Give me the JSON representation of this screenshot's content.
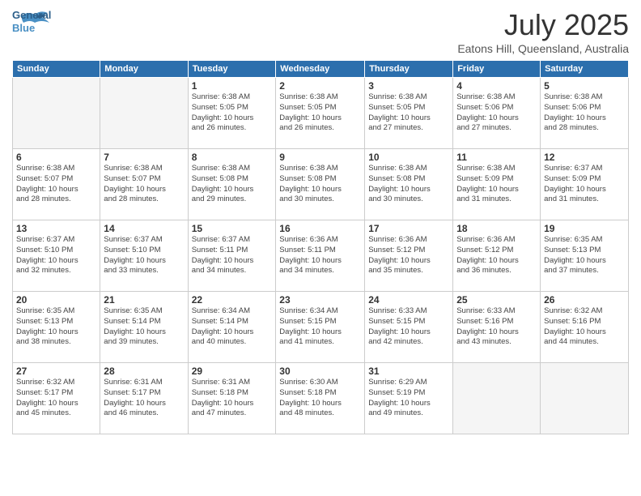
{
  "header": {
    "logo_general": "General",
    "logo_blue": "Blue",
    "title": "July 2025",
    "location": "Eatons Hill, Queensland, Australia"
  },
  "days_of_week": [
    "Sunday",
    "Monday",
    "Tuesday",
    "Wednesday",
    "Thursday",
    "Friday",
    "Saturday"
  ],
  "weeks": [
    [
      {
        "day": "",
        "info": ""
      },
      {
        "day": "",
        "info": ""
      },
      {
        "day": "1",
        "info": "Sunrise: 6:38 AM\nSunset: 5:05 PM\nDaylight: 10 hours\nand 26 minutes."
      },
      {
        "day": "2",
        "info": "Sunrise: 6:38 AM\nSunset: 5:05 PM\nDaylight: 10 hours\nand 26 minutes."
      },
      {
        "day": "3",
        "info": "Sunrise: 6:38 AM\nSunset: 5:05 PM\nDaylight: 10 hours\nand 27 minutes."
      },
      {
        "day": "4",
        "info": "Sunrise: 6:38 AM\nSunset: 5:06 PM\nDaylight: 10 hours\nand 27 minutes."
      },
      {
        "day": "5",
        "info": "Sunrise: 6:38 AM\nSunset: 5:06 PM\nDaylight: 10 hours\nand 28 minutes."
      }
    ],
    [
      {
        "day": "6",
        "info": "Sunrise: 6:38 AM\nSunset: 5:07 PM\nDaylight: 10 hours\nand 28 minutes."
      },
      {
        "day": "7",
        "info": "Sunrise: 6:38 AM\nSunset: 5:07 PM\nDaylight: 10 hours\nand 28 minutes."
      },
      {
        "day": "8",
        "info": "Sunrise: 6:38 AM\nSunset: 5:08 PM\nDaylight: 10 hours\nand 29 minutes."
      },
      {
        "day": "9",
        "info": "Sunrise: 6:38 AM\nSunset: 5:08 PM\nDaylight: 10 hours\nand 30 minutes."
      },
      {
        "day": "10",
        "info": "Sunrise: 6:38 AM\nSunset: 5:08 PM\nDaylight: 10 hours\nand 30 minutes."
      },
      {
        "day": "11",
        "info": "Sunrise: 6:38 AM\nSunset: 5:09 PM\nDaylight: 10 hours\nand 31 minutes."
      },
      {
        "day": "12",
        "info": "Sunrise: 6:37 AM\nSunset: 5:09 PM\nDaylight: 10 hours\nand 31 minutes."
      }
    ],
    [
      {
        "day": "13",
        "info": "Sunrise: 6:37 AM\nSunset: 5:10 PM\nDaylight: 10 hours\nand 32 minutes."
      },
      {
        "day": "14",
        "info": "Sunrise: 6:37 AM\nSunset: 5:10 PM\nDaylight: 10 hours\nand 33 minutes."
      },
      {
        "day": "15",
        "info": "Sunrise: 6:37 AM\nSunset: 5:11 PM\nDaylight: 10 hours\nand 34 minutes."
      },
      {
        "day": "16",
        "info": "Sunrise: 6:36 AM\nSunset: 5:11 PM\nDaylight: 10 hours\nand 34 minutes."
      },
      {
        "day": "17",
        "info": "Sunrise: 6:36 AM\nSunset: 5:12 PM\nDaylight: 10 hours\nand 35 minutes."
      },
      {
        "day": "18",
        "info": "Sunrise: 6:36 AM\nSunset: 5:12 PM\nDaylight: 10 hours\nand 36 minutes."
      },
      {
        "day": "19",
        "info": "Sunrise: 6:35 AM\nSunset: 5:13 PM\nDaylight: 10 hours\nand 37 minutes."
      }
    ],
    [
      {
        "day": "20",
        "info": "Sunrise: 6:35 AM\nSunset: 5:13 PM\nDaylight: 10 hours\nand 38 minutes."
      },
      {
        "day": "21",
        "info": "Sunrise: 6:35 AM\nSunset: 5:14 PM\nDaylight: 10 hours\nand 39 minutes."
      },
      {
        "day": "22",
        "info": "Sunrise: 6:34 AM\nSunset: 5:14 PM\nDaylight: 10 hours\nand 40 minutes."
      },
      {
        "day": "23",
        "info": "Sunrise: 6:34 AM\nSunset: 5:15 PM\nDaylight: 10 hours\nand 41 minutes."
      },
      {
        "day": "24",
        "info": "Sunrise: 6:33 AM\nSunset: 5:15 PM\nDaylight: 10 hours\nand 42 minutes."
      },
      {
        "day": "25",
        "info": "Sunrise: 6:33 AM\nSunset: 5:16 PM\nDaylight: 10 hours\nand 43 minutes."
      },
      {
        "day": "26",
        "info": "Sunrise: 6:32 AM\nSunset: 5:16 PM\nDaylight: 10 hours\nand 44 minutes."
      }
    ],
    [
      {
        "day": "27",
        "info": "Sunrise: 6:32 AM\nSunset: 5:17 PM\nDaylight: 10 hours\nand 45 minutes."
      },
      {
        "day": "28",
        "info": "Sunrise: 6:31 AM\nSunset: 5:17 PM\nDaylight: 10 hours\nand 46 minutes."
      },
      {
        "day": "29",
        "info": "Sunrise: 6:31 AM\nSunset: 5:18 PM\nDaylight: 10 hours\nand 47 minutes."
      },
      {
        "day": "30",
        "info": "Sunrise: 6:30 AM\nSunset: 5:18 PM\nDaylight: 10 hours\nand 48 minutes."
      },
      {
        "day": "31",
        "info": "Sunrise: 6:29 AM\nSunset: 5:19 PM\nDaylight: 10 hours\nand 49 minutes."
      },
      {
        "day": "",
        "info": ""
      },
      {
        "day": "",
        "info": ""
      }
    ]
  ]
}
